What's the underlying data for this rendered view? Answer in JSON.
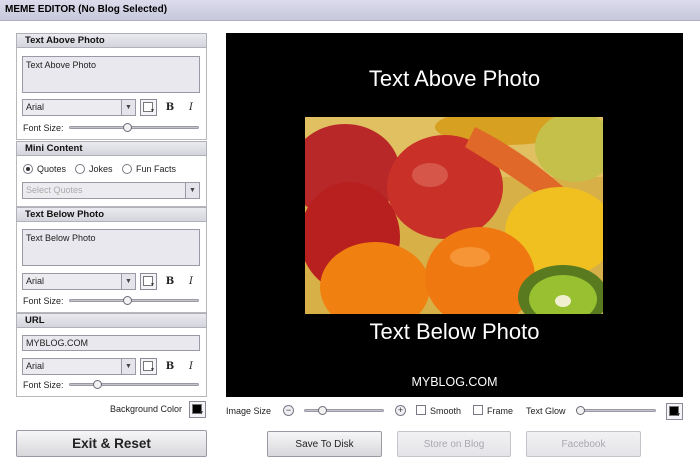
{
  "window": {
    "title": "MEME EDITOR (No Blog Selected)"
  },
  "text_above": {
    "header": "Text Above Photo",
    "value": "Text Above Photo",
    "font": "Arial",
    "font_size_label": "Font Size:",
    "font_size_level": 0.45,
    "bold_label": "B",
    "italic_label": "I"
  },
  "mini_content": {
    "header": "Mini Content",
    "options": [
      "Quotes",
      "Jokes",
      "Fun Facts"
    ],
    "selected_index": 0,
    "select_placeholder": "Select Quotes"
  },
  "text_below": {
    "header": "Text Below Photo",
    "value": "Text Below Photo",
    "font": "Arial",
    "font_size_label": "Font Size:",
    "font_size_level": 0.45,
    "bold_label": "B",
    "italic_label": "I"
  },
  "url": {
    "header": "URL",
    "value": "MYBLOG.COM",
    "font": "Arial",
    "font_size_label": "Font Size:",
    "font_size_level": 0.2,
    "bold_label": "B",
    "italic_label": "I"
  },
  "background_color": {
    "label": "Background Color",
    "color": "#000000"
  },
  "preview": {
    "text_above": "Text Above Photo",
    "text_below": "Text Below Photo",
    "url": "MYBLOG.COM",
    "background": "#000000"
  },
  "image_controls": {
    "image_size_label": "Image Size",
    "image_size_level": 0.2,
    "minus_icon": "minus-circle-icon",
    "plus_icon": "plus-circle-icon",
    "smooth_label": "Smooth",
    "smooth_checked": false,
    "frame_label": "Frame",
    "frame_checked": false,
    "text_glow_label": "Text Glow",
    "text_glow_level": 0.0,
    "glow_color": "#000000"
  },
  "buttons": {
    "exit_reset": "Exit & Reset",
    "save_to_disk": "Save To Disk",
    "store_on_blog": "Store on Blog",
    "facebook": "Facebook"
  }
}
